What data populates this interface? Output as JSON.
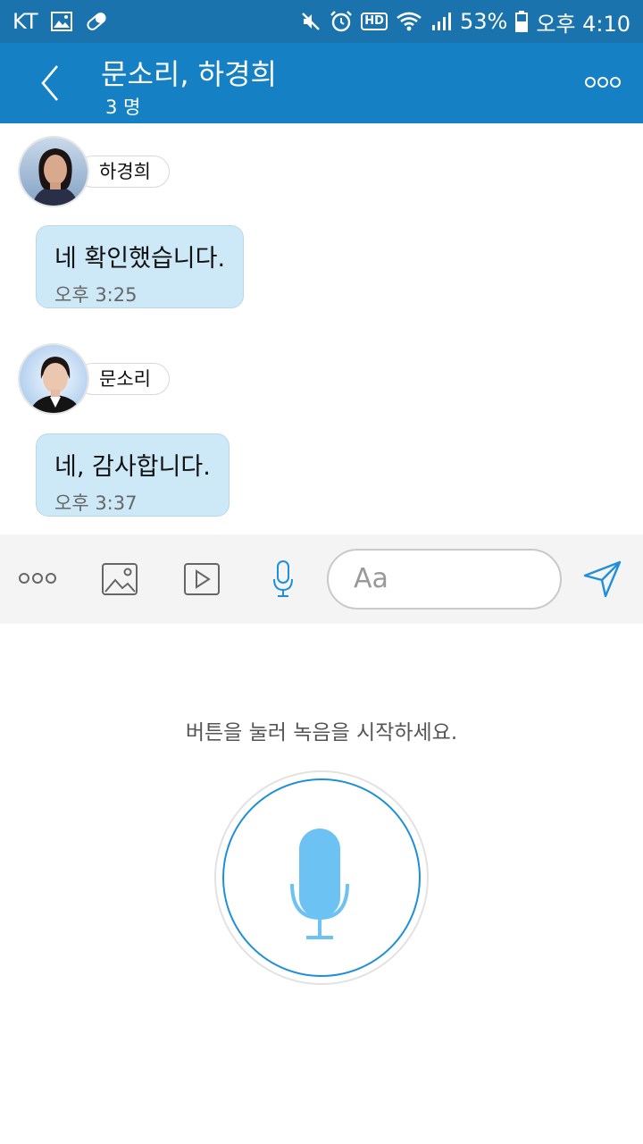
{
  "status_bar": {
    "carrier": "KT",
    "battery": "53%",
    "time": "오후 4:10",
    "hd_badge": "HD",
    "icons": [
      "image-icon",
      "pill-icon",
      "mute-icon",
      "alarm-icon",
      "hd-icon",
      "wifi-icon",
      "signal-icon",
      "battery-icon"
    ]
  },
  "header": {
    "title": "문소리, 하경희",
    "member_count": "3 명",
    "back_icon": "chevron-left-icon",
    "more_icon": "more-dots-icon",
    "background": "#1580c4"
  },
  "messages": [
    {
      "sender": "하경희",
      "text": "네 확인했습니다.",
      "time": "오후 3:25"
    },
    {
      "sender": "문소리",
      "text": "네, 감사합니다.",
      "time": "오후 3:37"
    }
  ],
  "input_bar": {
    "placeholder": "Aa",
    "icons": [
      "more-dots-icon",
      "image-icon",
      "video-icon",
      "microphone-icon",
      "send-icon"
    ],
    "accent": "#1e8fd8"
  },
  "record_panel": {
    "hint": "버튼을 눌러 녹음을 시작하세요.",
    "mic_color": "#6cc2f3"
  }
}
